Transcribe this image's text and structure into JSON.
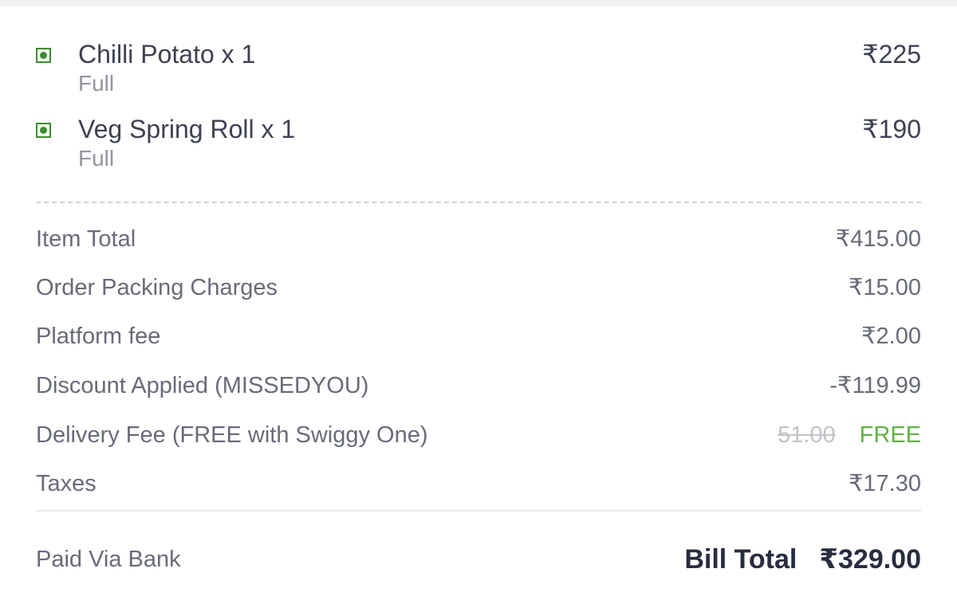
{
  "items": [
    {
      "name": "Chilli Potato x 1",
      "variant": "Full",
      "price": "₹225",
      "veg": true
    },
    {
      "name": "Veg Spring Roll x 1",
      "variant": "Full",
      "price": "₹190",
      "veg": true
    }
  ],
  "bill": {
    "item_total": {
      "label": "Item Total",
      "value": "₹415.00"
    },
    "packing": {
      "label": "Order Packing Charges",
      "value": "₹15.00"
    },
    "platform_fee": {
      "label": "Platform fee",
      "value": "₹2.00"
    },
    "discount": {
      "label": "Discount Applied (MISSEDYOU)",
      "value": "-₹119.99"
    },
    "delivery": {
      "label": "Delivery Fee (FREE with Swiggy One)",
      "original": "51.00",
      "value": "FREE"
    },
    "taxes": {
      "label": "Taxes",
      "value": "₹17.30"
    }
  },
  "footer": {
    "payment_method": "Paid Via Bank",
    "total_label": "Bill Total",
    "total_value": "₹329.00"
  },
  "colors": {
    "veg_green": "#3d8c2e",
    "free_green": "#60b246",
    "text_dark": "#282c3f",
    "text_muted": "#686b78"
  }
}
